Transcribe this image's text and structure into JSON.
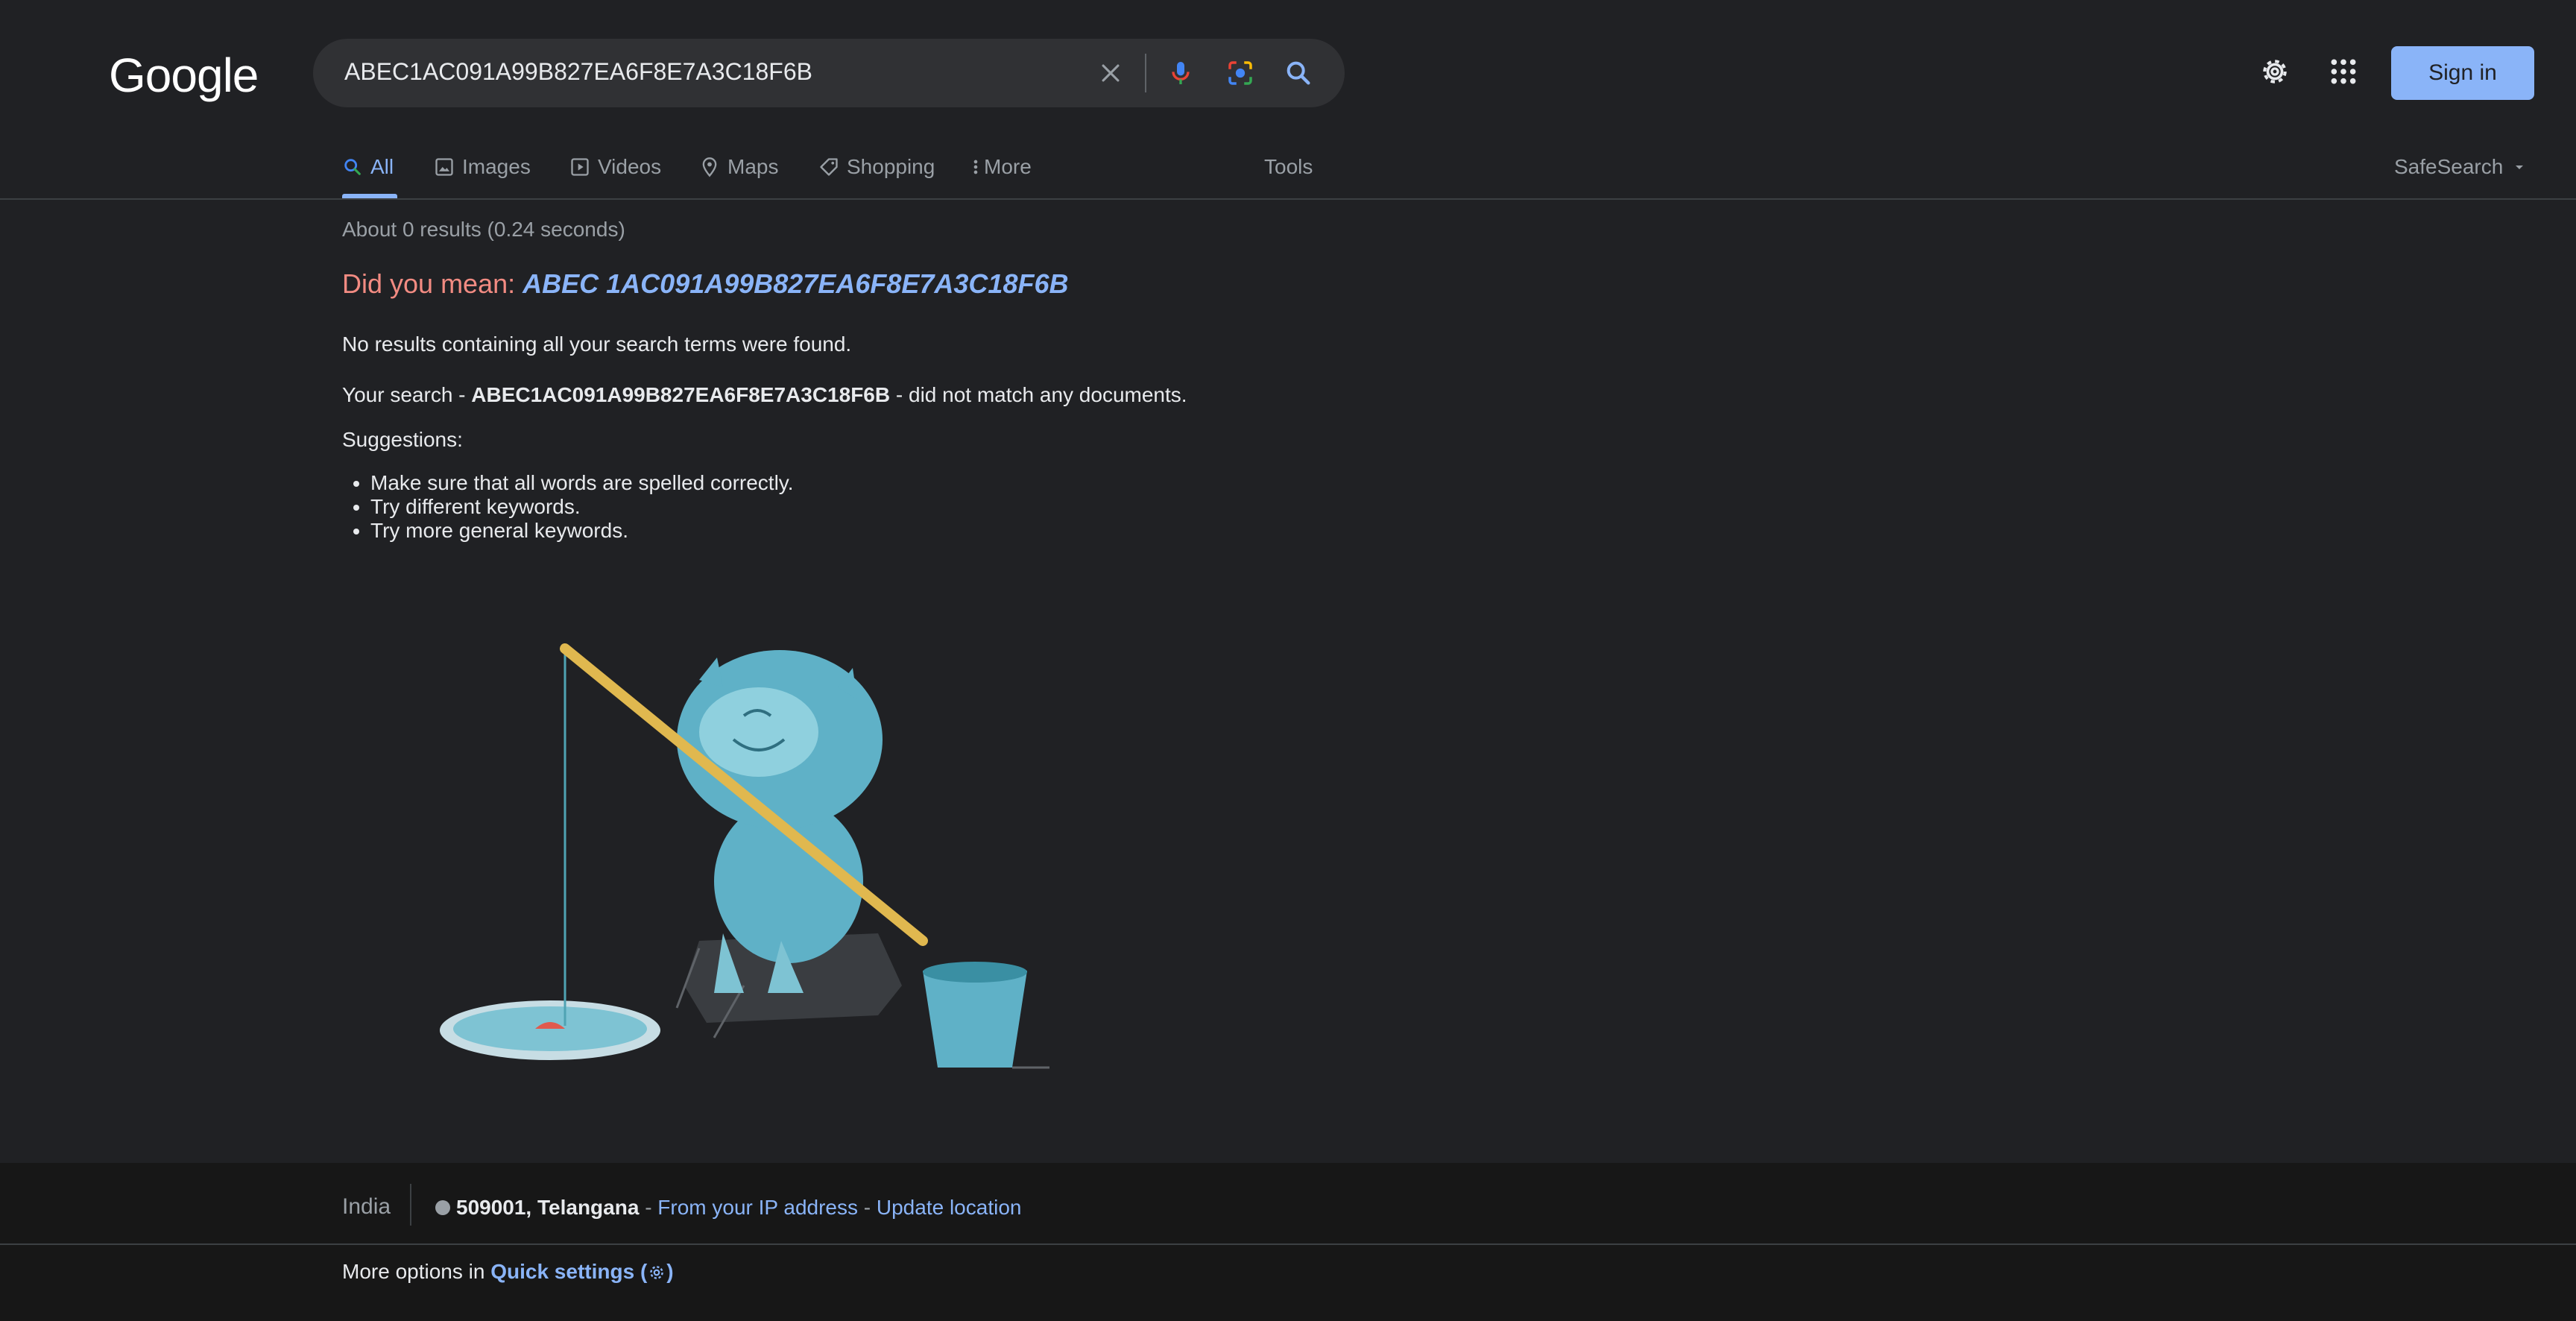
{
  "header": {
    "logo": "Google",
    "search_query": "ABEC1AC091A99B827EA6F8E7A3C18F6B",
    "sign_in_label": "Sign in"
  },
  "tabs": [
    {
      "label": "All",
      "icon": "search-icon",
      "active": true
    },
    {
      "label": "Images",
      "icon": "image-icon"
    },
    {
      "label": "Videos",
      "icon": "play-icon"
    },
    {
      "label": "Maps",
      "icon": "map-pin-icon"
    },
    {
      "label": "Shopping",
      "icon": "tag-icon"
    },
    {
      "label": "More",
      "icon": "more-vert-icon"
    }
  ],
  "tools_label": "Tools",
  "safesearch_label": "SafeSearch",
  "results": {
    "stats": "About 0 results (0.24 seconds)",
    "did_you_mean_label": "Did you mean:",
    "did_you_mean_query": "ABEC 1AC091A99B827EA6F8E7A3C18F6B",
    "no_results": "No results containing all your search terms were found.",
    "your_search_prefix": "Your search -",
    "your_search_term": "ABEC1AC091A99B827EA6F8E7A3C18F6B",
    "your_search_suffix": "- did not match any documents.",
    "suggestions_heading": "Suggestions:",
    "suggestions": [
      "Make sure that all words are spelled correctly.",
      "Try different keywords.",
      "Try more general keywords."
    ]
  },
  "footer": {
    "country": "India",
    "location": "509001, Telangana",
    "sep1": "-",
    "from_ip": "From your IP address",
    "sep2": "-",
    "update_location": "Update location",
    "more_options_prefix": "More options in",
    "quick_settings": "Quick settings",
    "quick_settings_open": "(",
    "quick_settings_close": ")"
  },
  "colors": {
    "background": "#202124",
    "accent": "#8ab4f8",
    "did_you_mean": "#f28b82",
    "footer_bg": "#171717"
  }
}
